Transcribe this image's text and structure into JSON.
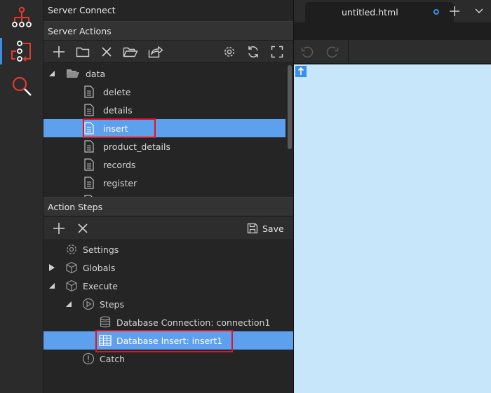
{
  "rail": {
    "items": [
      {
        "name": "sitemap-icon"
      },
      {
        "name": "server-connect-icon",
        "active": true
      },
      {
        "name": "search-icon"
      }
    ]
  },
  "panel": {
    "title": "Server Connect",
    "server_actions": {
      "header": "Server Actions",
      "tree": [
        {
          "label": "data",
          "type": "folder",
          "expanded": true
        },
        {
          "label": "delete",
          "type": "file"
        },
        {
          "label": "details",
          "type": "file"
        },
        {
          "label": "insert",
          "type": "file",
          "selected": true
        },
        {
          "label": "product_details",
          "type": "file"
        },
        {
          "label": "records",
          "type": "file"
        },
        {
          "label": "register",
          "type": "file"
        }
      ]
    },
    "action_steps": {
      "header": "Action Steps",
      "save_label": "Save",
      "tree": [
        {
          "label": "Settings",
          "icon": "gear-icon"
        },
        {
          "label": "Globals",
          "icon": "cube-icon",
          "expanded": false
        },
        {
          "label": "Execute",
          "icon": "cube-icon",
          "expanded": true
        },
        {
          "label": "Steps",
          "icon": "play-circle-icon",
          "expanded": true
        },
        {
          "label": "Database Connection: connection1",
          "icon": "database-icon"
        },
        {
          "label": "Database Insert: insert1",
          "icon": "table-icon",
          "selected": true
        },
        {
          "label": "Catch",
          "icon": "alert-circle-icon"
        }
      ]
    }
  },
  "editor": {
    "tab_label": "untitled.html",
    "colors": {
      "accent": "#3d8ee6",
      "selection": "#5da0ee",
      "canvas": "#c8e6fa",
      "highlight": "#e0161e"
    }
  }
}
